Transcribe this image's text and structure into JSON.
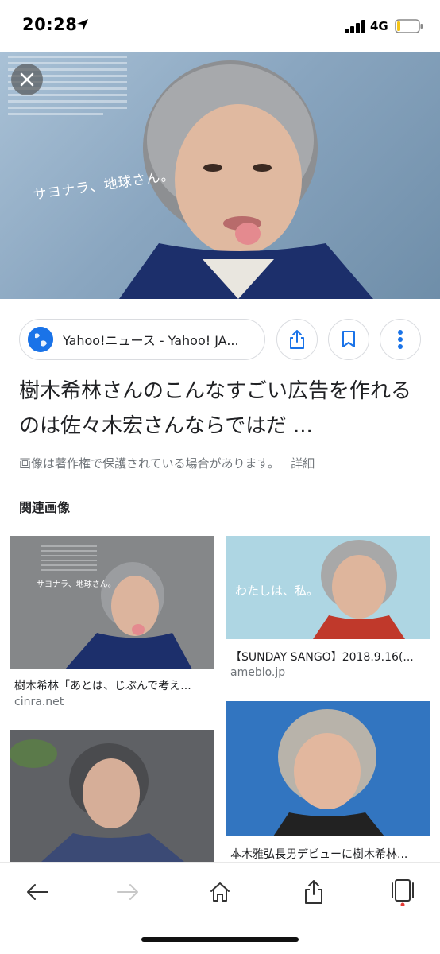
{
  "status_bar": {
    "time": "20:28",
    "network": "4G",
    "location_icon": "location-arrow-icon",
    "signal_icon": "signal-bars-icon",
    "battery_icon": "battery-low-icon"
  },
  "hero": {
    "tagline": "サヨナラ、地球さん。",
    "close_icon": "close-icon"
  },
  "source": {
    "label": "Yahoo!ニュース - Yahoo! JA...",
    "icon": "globe-icon"
  },
  "actions": {
    "share_icon": "share-icon",
    "bookmark_icon": "bookmark-icon",
    "more_icon": "more-vertical-icon"
  },
  "result": {
    "title": "樹木希林さんのこんなすごい広告を作れるのは佐々木宏さんならではだ ...",
    "notice": "画像は著作権で保護されている場合があります。",
    "details_link": "詳細"
  },
  "related": {
    "heading": "関連画像",
    "items": [
      {
        "title": "樹木希林「あとは、じぶんで考え...",
        "domain": "cinra.net",
        "overlay": "サヨナラ、地球さん。"
      },
      {
        "title": "【SUNDAY SANGO】2018.9.16(...",
        "domain": "ameblo.jp",
        "overlay": "わたしは、私。"
      },
      {
        "title": "",
        "domain": ""
      },
      {
        "title": "本木雅弘長男デビューに樹木希林...",
        "domain": ""
      }
    ]
  },
  "bottom_nav": {
    "back_icon": "back-arrow-icon",
    "forward_icon": "forward-arrow-icon",
    "home_icon": "home-icon",
    "share_icon": "share-icon",
    "tabs_icon": "tabs-icon"
  },
  "colors": {
    "accent": "#1a73e8",
    "notification_dot": "#e53935",
    "text_primary": "#202124",
    "text_secondary": "#70757a"
  }
}
